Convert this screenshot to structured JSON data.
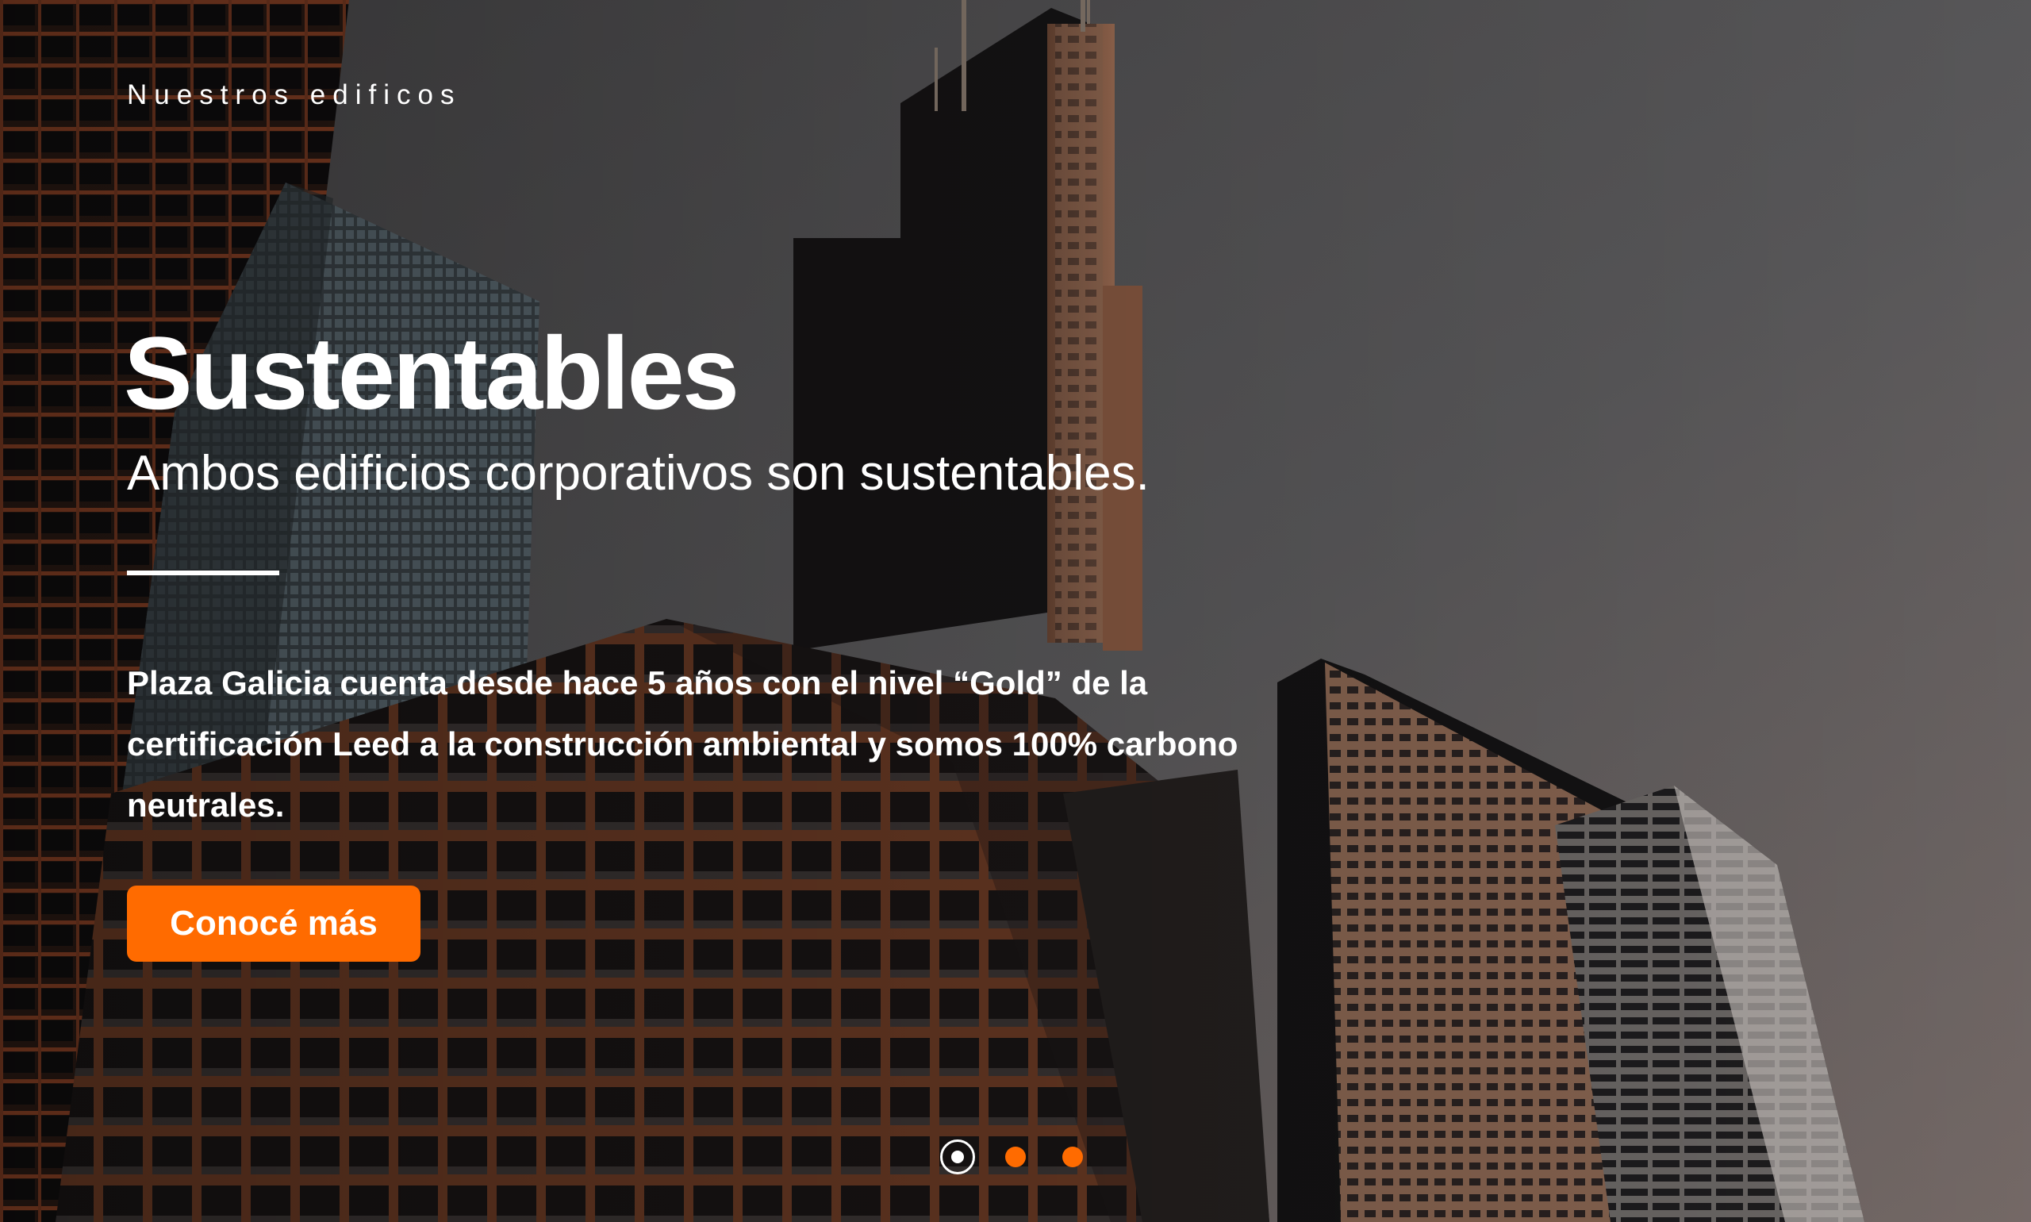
{
  "hero": {
    "eyebrow": "Nuestros edificos",
    "title": "Sustentables",
    "subtitle": "Ambos edificios corporativos son sustentables.",
    "body": "Plaza Galicia cuenta desde hace 5 años con el nivel “Gold” de la certificación Leed a la construcción ambiental y somos 100% carbono neutrales.",
    "cta_label": "Conocé más"
  },
  "carousel": {
    "active_slide": 1,
    "slide_count": 3
  },
  "colors": {
    "accent": "#ff6b00",
    "text": "#ffffff",
    "sky": "#5b5a5c"
  },
  "background": {
    "image_subject": "skyscrapers-photo"
  }
}
